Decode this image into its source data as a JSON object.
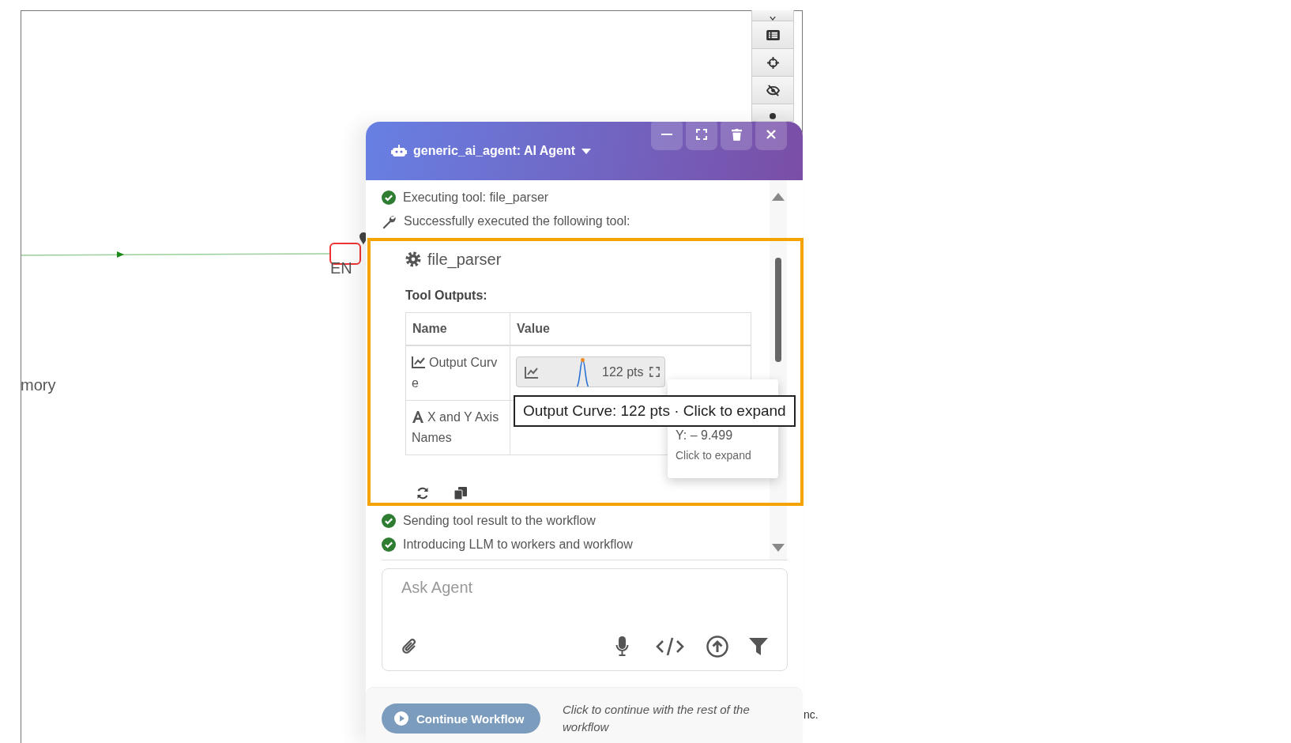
{
  "canvas": {
    "node_labels": [
      {
        "text": "EN"
      },
      {
        "text": "mory"
      }
    ],
    "footer_text": "nc."
  },
  "agent_panel": {
    "title": "generic_ai_agent: AI Agent",
    "messages": [
      {
        "kind": "done",
        "text": "Executing tool: file_parser"
      },
      {
        "kind": "tool",
        "text": "Successfully executed the following tool:"
      }
    ],
    "tool_card": {
      "name": "file_parser",
      "outputs_title": "Tool Outputs:",
      "columns": [
        "Name",
        "Value"
      ],
      "rows": [
        {
          "kind": "curve",
          "name": "Output Curve",
          "value": "122 pts"
        },
        {
          "kind": "text",
          "name": "X and Y Axis Names"
        }
      ]
    },
    "tooltip": "Output Curve: 122 pts · Click to expand",
    "point_popup": {
      "reading": "Y: – 9.499",
      "hint": "Click to expand"
    },
    "after_messages": [
      {
        "kind": "done",
        "text": "Sending tool result to the workflow"
      },
      {
        "kind": "done",
        "text": "Introducing LLM to workers and workflow"
      }
    ],
    "input": {
      "placeholder": "Ask Agent"
    },
    "continue": {
      "label": "Continue Workflow",
      "hint": "Click to continue with the rest of the workflow"
    }
  }
}
